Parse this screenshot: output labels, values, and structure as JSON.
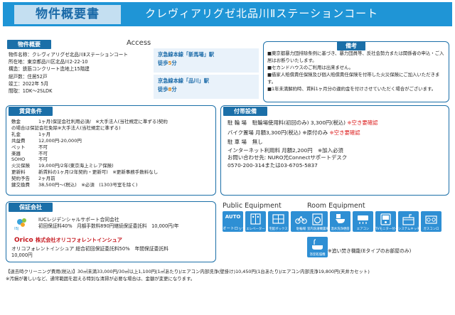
{
  "header": {
    "title": "物件概要書",
    "property_name": "クレヴィアリグゼ北品川Ⅱステーションコート"
  },
  "overview": {
    "label": "物件概要",
    "lines": [
      "物件名称：クレヴィアリグゼ北品川Ⅱステーションコート",
      "所在地：東京都品川区北品川2-22-10",
      "構造：鉄筋コンクリート造地上15階建",
      "総戸数：住居52戸",
      "竣工：2022年 5月",
      "間取：1DK～2SLDK"
    ]
  },
  "access": {
    "title": "Access",
    "routes": [
      {
        "line": "京急線本線「新馬場」駅",
        "walk_prefix": "徒歩",
        "minutes": "5",
        "walk_suffix": "分"
      },
      {
        "line": "京急線本線「品川」駅",
        "walk_prefix": "徒歩",
        "minutes": "8",
        "walk_suffix": "分"
      }
    ]
  },
  "remarks": {
    "label": "備考",
    "lines": [
      "■東京都暴力団排除条例に基づき、暴力団員等、反社会勢力または関係者の申込・ご入居はお断りいたします。",
      "■セカンドハウスのご利用は出来ません。",
      "■借家人賠償責任保険及び個人賠償責任保険を付帯した火災保険にご加入いただきます。",
      "■1年未満解約時、賃料1ヶ月分の違約金を付けさせていただく場合がございます。"
    ]
  },
  "lease": {
    "label": "賃貸条件",
    "rows": [
      {
        "key": "敷金",
        "value": "1ヶ月(保証会社利用必須/　※大手法人(当社規定に準ずる)契約"
      },
      {
        "key": "",
        "value": "の場合は保証会社免除※大手法人(当社規定に準ずる)"
      },
      {
        "key": "礼金",
        "value": "1ヶ月"
      },
      {
        "key": "共益費",
        "value": "12,000円-20,000円"
      },
      {
        "key": "ペット",
        "value": "不可"
      },
      {
        "key": "楽器",
        "value": "不可"
      },
      {
        "key": "SOHO",
        "value": "不可"
      },
      {
        "key": "火災保険",
        "value": "19,000円/2年(東京海上ミレア保険)"
      },
      {
        "key": "更新料",
        "value": "新賃料の1ヶ月(2年契約・更新可)　※更新事務手数料なし"
      },
      {
        "key": "契約予告",
        "value": "2ヶ月前"
      },
      {
        "key": "鍵交換費",
        "value": "38,500円～(税込)　※必須　(1303号室を除く)"
      }
    ]
  },
  "facilities": {
    "label": "付帯設備",
    "bicycle": {
      "label": "駐 輪 場",
      "value": "駐輪場使用料(初回のみ) 3,300円(税込)",
      "note": "※空き要確認"
    },
    "bike": {
      "label": "バイク置場",
      "value": "月額3,300円(税込) ※原付のみ",
      "note": "※空き要確認"
    },
    "parking": {
      "label": "駐 車 場",
      "value": "無し"
    },
    "internet": [
      "インターネット利用料 月額2,200円　※加入必須",
      "お問い合わせ先: NURO光Connectサポートデスク",
      "0570-200-314または03-6705-5837"
    ]
  },
  "guarantee": {
    "label": "保証会社",
    "companies": [
      {
        "logo": "IBJ",
        "name": "IUCレジデンシャルサポート合同会社",
        "line": "初回保証料40%　月額手数料890円継続保証委託料　10,000円/年"
      },
      {
        "logo": "Orico",
        "logo_sub": "株式会社オリコフォレントインシュア",
        "name": "オリコフォレントインシュア 総合初回保証委託料50%　年間保証委託料",
        "line": "10,000円"
      }
    ]
  },
  "public_equipment": {
    "title": "Public Equipment",
    "items": [
      {
        "name": "auto-lock",
        "label": "オートロック",
        "glyph": "AUTO"
      },
      {
        "name": "elevator",
        "label": "エレベーター"
      },
      {
        "name": "delivery-box",
        "label": "宅配ボックス"
      },
      {
        "name": "bicycle-parking",
        "label": "駐輪場"
      }
    ]
  },
  "room_equipment": {
    "title": "Room Equipment",
    "items": [
      {
        "name": "washing-machine-space",
        "label": "室内洗濯機置場"
      },
      {
        "name": "washlet",
        "label": "温水洗浄便座"
      },
      {
        "name": "air-conditioner",
        "label": "エアコン"
      },
      {
        "name": "tv-monitor-intercom",
        "label": "TVモニター付インターフォン"
      },
      {
        "name": "system-kitchen",
        "label": "システムキッチン"
      },
      {
        "name": "gas-stove",
        "label": "ガスコンロ"
      },
      {
        "name": "bathroom-dryer",
        "label": "浴室乾燥機"
      }
    ],
    "note": "※追い焚き機能(Eタイプのお部屋のみ)"
  },
  "footer": {
    "lines": [
      "【退去時クリーニング費用(税込)】30㎡未満33,000円/30㎡以上1,100円(1㎡あたり)/エアコン内部洗浄(壁掛け)10,450円(1台あたり)/エアコン内部洗浄19,800円(天井カセット)",
      "※汚損が著しいなど、通常範囲を超える特別な清掃が必要な場合は、金額が変更になります。"
    ]
  },
  "colors": {
    "header_blue": "#1f95d6",
    "label_navy": "#1b6fa8",
    "accent_red": "#d22222",
    "accent_orange": "#e08a1e"
  }
}
